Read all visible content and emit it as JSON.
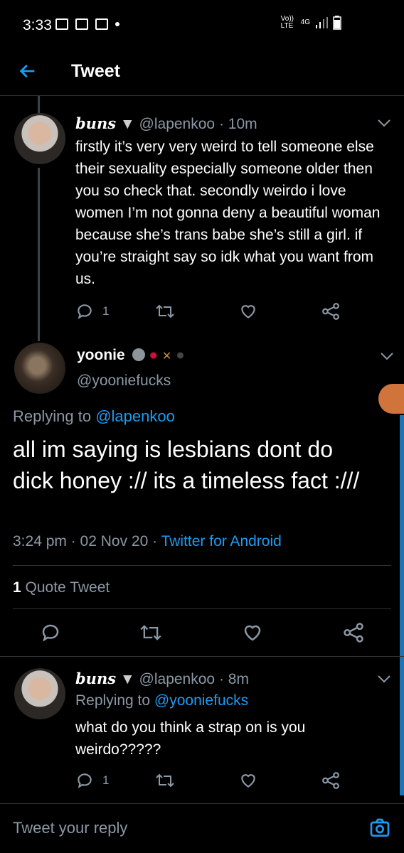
{
  "status_bar": {
    "time": "3:33",
    "network": "4G",
    "volte": "Vo)) LTE"
  },
  "header": {
    "title": "Tweet"
  },
  "tweet1": {
    "name": "buns",
    "handle": "@lapenkoo",
    "time": "· 10m",
    "text": "firstly it’s very very weird to tell someone else their sexuality especially someone older then you so check that. secondly weirdo i love women I’m not gonna deny a beautiful woman because she’s trans babe she’s still a girl. if you’re straight say so idk what you want from us.",
    "reply_count": "1"
  },
  "main_tweet": {
    "name": "yoonie",
    "handle": "@yooniefucks",
    "replying_prefix": "Replying to",
    "replying_to": "@lapenkoo",
    "text": "all im saying is lesbians dont do dick honey :// its a timeless fact :///",
    "timestamp": "3:24 pm · 02 Nov 20 ·",
    "source": "Twitter for Android",
    "quote_count": "1",
    "quote_label": "Quote Tweet"
  },
  "reply_tweet": {
    "name": "buns",
    "handle": "@lapenkoo",
    "time": "· 8m",
    "replying_prefix": "Replying to",
    "replying_to": "@yooniefucks",
    "text": "what do you think a strap on is you weirdo?????",
    "reply_count": "1"
  },
  "composer": {
    "placeholder": "Tweet your reply"
  },
  "icons": [
    "back-arrow-icon",
    "reply-icon",
    "retweet-icon",
    "like-icon",
    "share-icon",
    "camera-icon",
    "chevron-down-icon"
  ],
  "colors": {
    "accent": "#1d9bf0",
    "background": "#000000",
    "secondary_text": "#8b98a5"
  }
}
